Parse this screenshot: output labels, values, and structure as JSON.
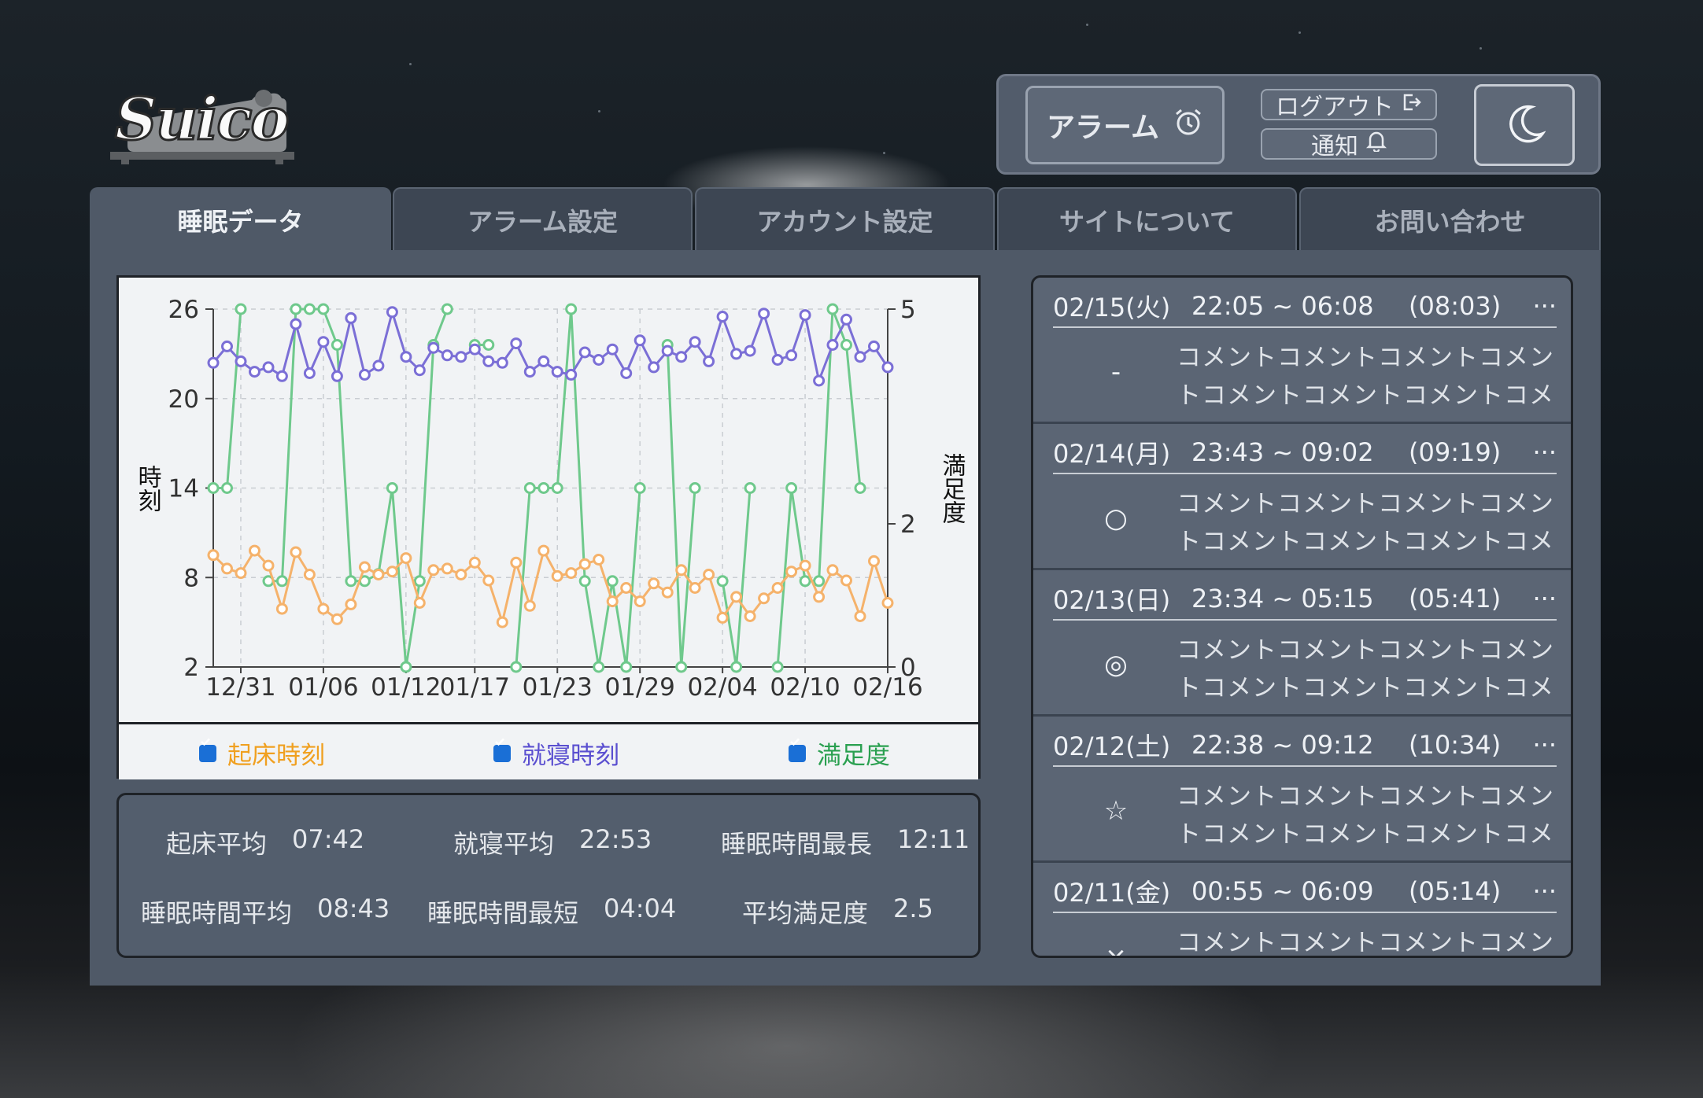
{
  "app": {
    "logo_text": "Suico"
  },
  "header": {
    "alarm_label": "アラーム",
    "logout_label": "ログアウト",
    "notify_label": "通知",
    "theme_icon": "moon-icon"
  },
  "tabs": [
    {
      "label": "睡眠データ",
      "active": true
    },
    {
      "label": "アラーム設定",
      "active": false
    },
    {
      "label": "アカウント設定",
      "active": false
    },
    {
      "label": "サイトについて",
      "active": false
    },
    {
      "label": "お問い合わせ",
      "active": false
    }
  ],
  "chart_data": {
    "type": "line",
    "x": [
      "12/29",
      "12/30",
      "12/31",
      "01/01",
      "01/02",
      "01/03",
      "01/04",
      "01/05",
      "01/06",
      "01/07",
      "01/08",
      "01/09",
      "01/10",
      "01/11",
      "01/12",
      "01/13",
      "01/14",
      "01/15",
      "01/16",
      "01/17",
      "01/18",
      "01/19",
      "01/20",
      "01/21",
      "01/22",
      "01/23",
      "01/24",
      "01/25",
      "01/26",
      "01/27",
      "01/28",
      "01/29",
      "01/30",
      "01/31",
      "02/01",
      "02/02",
      "02/03",
      "02/04",
      "02/05",
      "02/06",
      "02/07",
      "02/08",
      "02/09",
      "02/10",
      "02/11",
      "02/12",
      "02/13",
      "02/14",
      "02/15",
      "02/16"
    ],
    "x_ticks": [
      "12/31",
      "01/06",
      "01/12",
      "01/17",
      "01/23",
      "01/29",
      "02/04",
      "02/10",
      "02/16"
    ],
    "ylabel": "時刻",
    "y2label": "満足度",
    "y_ticks": [
      "26",
      "20",
      "14",
      "8",
      "2"
    ],
    "y2_ticks": [
      "5",
      "2",
      "0"
    ],
    "ylim": [
      2,
      26
    ],
    "y2lim": [
      0,
      5
    ],
    "grid": true,
    "series": [
      {
        "name": "就寝時刻",
        "color": "#7b6fd6",
        "axis": "left",
        "values": [
          22.4,
          23.5,
          22.5,
          21.8,
          22.1,
          21.5,
          25,
          21.7,
          23.8,
          21.5,
          25.4,
          21.6,
          22.2,
          25.8,
          22.8,
          21.9,
          23.4,
          22.9,
          22.8,
          23.3,
          22.5,
          22.4,
          23.7,
          21.8,
          22.5,
          21.8,
          21.6,
          23.1,
          22.6,
          23.3,
          21.7,
          23.9,
          22.1,
          23.2,
          22.8,
          23.8,
          22.5,
          25.5,
          23.0,
          23.2,
          25.7,
          22.6,
          22.9,
          25.6,
          21.2,
          23.6,
          25.3,
          22.8,
          23.5,
          22.1
        ]
      },
      {
        "name": "起床時刻",
        "color": "#f5b26b",
        "axis": "left",
        "values": [
          9.5,
          8.6,
          8.3,
          9.8,
          8.8,
          5.9,
          9.7,
          8.2,
          5.9,
          5.2,
          6.2,
          8.7,
          8.2,
          8.4,
          9.3,
          6.3,
          8.5,
          8.6,
          8.2,
          9.0,
          7.8,
          5.0,
          9.0,
          6.1,
          9.8,
          8.1,
          8.3,
          8.9,
          9.2,
          6.4,
          7.3,
          6.4,
          7.6,
          7.0,
          8.5,
          7.3,
          8.2,
          5.3,
          6.7,
          5.4,
          6.6,
          7.3,
          8.4,
          8.8,
          6.7,
          8.5,
          7.8,
          5.4,
          9.1,
          6.3
        ]
      },
      {
        "name": "満足度",
        "color": "#6fc98c",
        "axis": "right",
        "values": [
          2.5,
          2.5,
          5,
          null,
          1.2,
          1.2,
          5,
          5,
          5,
          4.5,
          1.2,
          1.2,
          1.3,
          2.5,
          0,
          1.2,
          4.5,
          5,
          null,
          4.5,
          4.5,
          null,
          0,
          2.5,
          2.5,
          2.5,
          5,
          1.2,
          0,
          1.2,
          0,
          2.5,
          null,
          4.5,
          0,
          2.5,
          null,
          1.2,
          0,
          2.5,
          null,
          0,
          2.5,
          1.2,
          1.2,
          5,
          4.5,
          2.5,
          null,
          null
        ]
      }
    ]
  },
  "legend": [
    {
      "label": "起床時刻",
      "color": "#f0a020",
      "checked": true
    },
    {
      "label": "就寝時刻",
      "color": "#5a4fd0",
      "checked": true
    },
    {
      "label": "満足度",
      "color": "#2aa050",
      "checked": true
    }
  ],
  "stats": {
    "wake_avg_label": "起床平均",
    "wake_avg_value": "07:42",
    "bed_avg_label": "就寝平均",
    "bed_avg_value": "22:53",
    "sleep_max_label": "睡眠時間最長",
    "sleep_max_value": "12:11",
    "sleep_avg_label": "睡眠時間平均",
    "sleep_avg_value": "08:43",
    "sleep_min_label": "睡眠時間最短",
    "sleep_min_value": "04:04",
    "satisfaction_avg_label": "平均満足度",
    "satisfaction_avg_value": "2.5"
  },
  "records": [
    {
      "date": "02/15(火)",
      "time": "22:05 ~ 06:08",
      "duration": "(08:03)",
      "more": "···",
      "mark": "-",
      "comment": "コメントコメントコメントコメントコメントコメントコメントコメ"
    },
    {
      "date": "02/14(月)",
      "time": "23:43 ~ 09:02",
      "duration": "(09:19)",
      "more": "···",
      "mark": "○",
      "comment": "コメントコメントコメントコメントコメントコメントコメントコメ"
    },
    {
      "date": "02/13(日)",
      "time": "23:34 ~ 05:15",
      "duration": "(05:41)",
      "more": "···",
      "mark": "◎",
      "comment": "コメントコメントコメントコメントコメントコメントコメントコメ"
    },
    {
      "date": "02/12(土)",
      "time": "22:38 ~ 09:12",
      "duration": "(10:34)",
      "more": "···",
      "mark": "☆",
      "comment": "コメントコメントコメントコメントコメントコメントコメントコメ"
    },
    {
      "date": "02/11(金)",
      "time": "00:55 ~ 06:09",
      "duration": "(05:14)",
      "more": "···",
      "mark": "×",
      "comment": "コメントコメントコメントコメントコメントコメントコメントコメ"
    }
  ]
}
